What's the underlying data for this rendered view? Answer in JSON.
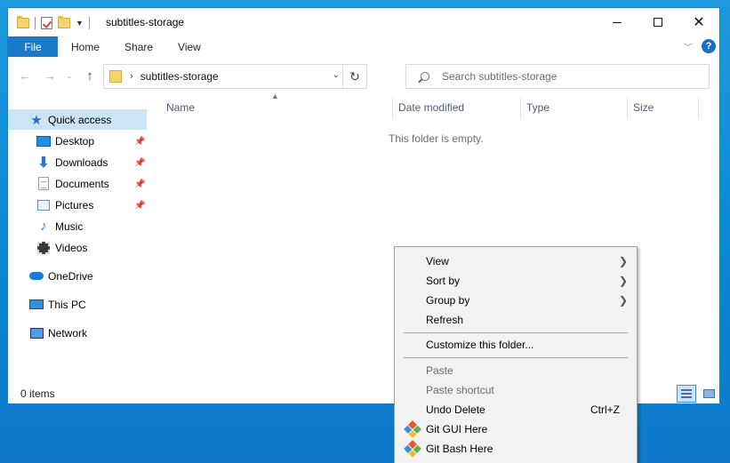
{
  "window": {
    "title": "subtitles-storage",
    "controls": {
      "minimize": "minimize",
      "maximize": "maximize",
      "close": "✕"
    }
  },
  "ribbon": {
    "file_tab": "File",
    "tabs": [
      "Home",
      "Share",
      "View"
    ]
  },
  "nav": {
    "back": "←",
    "forward": "→",
    "recent": "⌄",
    "up": "↑",
    "address": "subtitles-storage",
    "address_chevron": "›",
    "address_dropdown": "⌄",
    "refresh": "↻",
    "search_placeholder": "Search subtitles-storage"
  },
  "navpane": {
    "quick_access": "Quick access",
    "quick_items": [
      {
        "label": "Desktop",
        "icon": "desktop-icon",
        "pinned": true
      },
      {
        "label": "Downloads",
        "icon": "downloads-icon",
        "pinned": true
      },
      {
        "label": "Documents",
        "icon": "documents-icon",
        "pinned": true
      },
      {
        "label": "Pictures",
        "icon": "pictures-icon",
        "pinned": true
      },
      {
        "label": "Music",
        "icon": "music-icon",
        "pinned": false
      },
      {
        "label": "Videos",
        "icon": "videos-icon",
        "pinned": false
      }
    ],
    "onedrive": "OneDrive",
    "this_pc": "This PC",
    "network": "Network"
  },
  "content": {
    "columns": [
      "Name",
      "Date modified",
      "Type",
      "Size"
    ],
    "empty_message": "This folder is empty."
  },
  "status": {
    "item_count": "0 items"
  },
  "context_menu": {
    "view": "View",
    "sort_by": "Sort by",
    "group_by": "Group by",
    "refresh": "Refresh",
    "customize": "Customize this folder...",
    "paste": "Paste",
    "paste_shortcut": "Paste shortcut",
    "undo_delete": "Undo Delete",
    "undo_shortcut": "Ctrl+Z",
    "git_gui": "Git GUI Here",
    "git_bash": "Git Bash Here",
    "submenu_arrow": "❯"
  },
  "colors": {
    "accent": "#1979ca",
    "selection": "#cce4f7",
    "desktop": "#0a87d6",
    "git": [
      "#f05133",
      "#5bb346",
      "#3a8fd9",
      "#f0c020"
    ]
  }
}
